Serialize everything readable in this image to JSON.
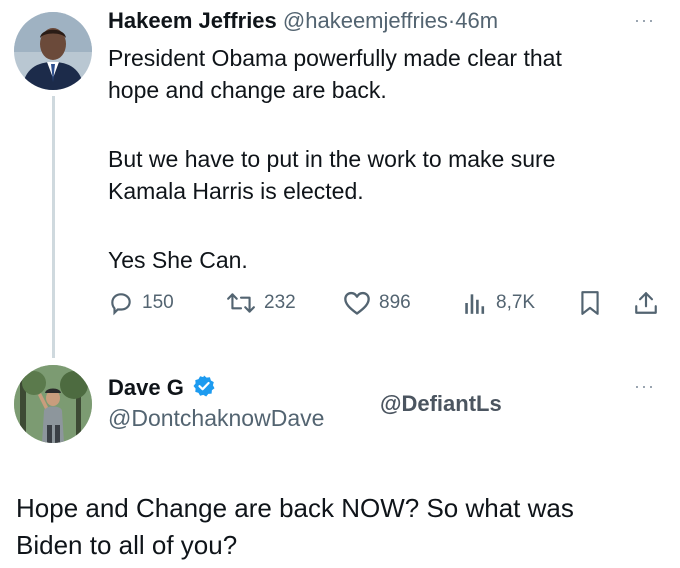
{
  "tweet1": {
    "author_name": "Hakeem Jeffries",
    "handle": "@hakeemjeffries",
    "separator": "·",
    "time": "46m",
    "lines": [
      "President Obama powerfully made clear that",
      "hope and change are back.",
      "",
      "But we have to put in the work to make sure",
      "Kamala Harris is elected.",
      "",
      "Yes She Can."
    ],
    "actions": {
      "replies": "150",
      "reposts": "232",
      "likes": "896",
      "views": "8,7K"
    },
    "more": "···"
  },
  "tweet2": {
    "author_name": "Dave G",
    "handle": "@DontchaknowDave",
    "watermark": "@DefiantLs",
    "more": "···",
    "lines": [
      "Hope and Change are back NOW? So what was",
      "Biden to all of you?"
    ]
  },
  "icons": {
    "reply": "reply-icon",
    "repost": "repost-icon",
    "like": "like-icon",
    "views": "views-icon",
    "bookmark": "bookmark-icon",
    "share": "share-icon",
    "verified": "verified-badge-icon"
  },
  "colors": {
    "text": "#0f1419",
    "muted": "#536471",
    "verified": "#1d9bf0",
    "thread_line": "#cfd9de"
  }
}
